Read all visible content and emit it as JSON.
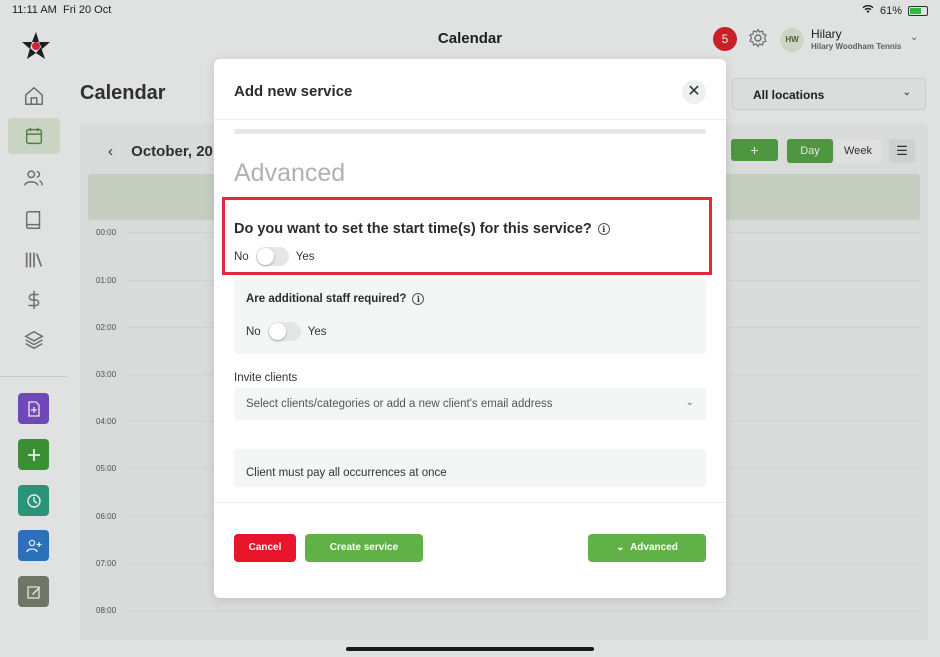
{
  "status_bar": {
    "time": "11:11 AM",
    "date": "Fri 20 Oct",
    "battery": "61%"
  },
  "header": {
    "title": "Calendar",
    "notification_count": "5",
    "user": {
      "initials": "HW",
      "name": "Hilary",
      "org": "Hilary Woodham Tennis"
    }
  },
  "sidebar": {
    "nav_icons": [
      "home-icon",
      "calendar-icon",
      "clients-icon",
      "book-icon",
      "library-icon",
      "dollar-icon",
      "layers-icon"
    ],
    "quick_actions": [
      {
        "icon": "add-document-icon",
        "color": "#7b4fc7"
      },
      {
        "icon": "plus-icon",
        "color": "#3f9c3a"
      },
      {
        "icon": "clock-icon",
        "color": "#2fa183"
      },
      {
        "icon": "add-user-icon",
        "color": "#2e7bc9"
      },
      {
        "icon": "edit-icon",
        "color": "#7a7f6e"
      }
    ]
  },
  "calendar": {
    "page_title": "Calendar",
    "location_select": "All locations",
    "month_label": "October, 20",
    "add_button": "+",
    "views": [
      "Day",
      "Week"
    ],
    "hours": [
      "00:00",
      "01:00",
      "02:00",
      "03:00",
      "04:00",
      "05:00",
      "06:00",
      "07:00",
      "08:00"
    ]
  },
  "modal": {
    "title": "Add new service",
    "close_label": "✕",
    "section_title": "Advanced",
    "start_time": {
      "question": "Do you want to set the start time(s) for this service?",
      "no_label": "No",
      "yes_label": "Yes"
    },
    "staff": {
      "question": "Are additional staff required?",
      "no_label": "No",
      "yes_label": "Yes"
    },
    "invite": {
      "label": "Invite clients",
      "placeholder": "Select clients/categories or add a new client's email address"
    },
    "payment_label": "Client must pay all occurrences at once",
    "buttons": {
      "cancel": "Cancel",
      "create": "Create service",
      "advanced": "Advanced"
    }
  },
  "colors": {
    "accent_green": "#60b247",
    "danger_red": "#e8152b",
    "highlight_red": "#e4283c"
  }
}
